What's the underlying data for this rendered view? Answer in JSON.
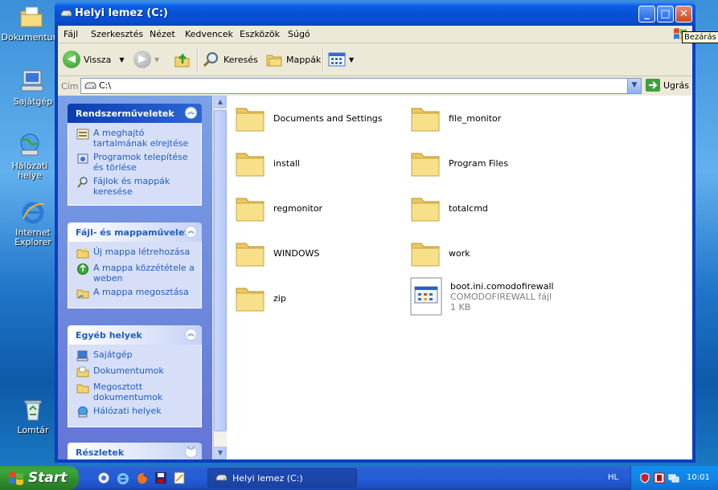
{
  "desktop": {
    "icons": [
      {
        "label": "Dokumentum",
        "icon": "my-documents-icon"
      },
      {
        "label": "Sajátgép",
        "icon": "my-computer-icon"
      },
      {
        "label": "Hálózati helye",
        "icon": "network-places-icon"
      },
      {
        "label": "Internet Explorer",
        "icon": "internet-explorer-icon"
      },
      {
        "label": "Lomtár",
        "icon": "recycle-bin-icon"
      }
    ]
  },
  "tooltip": "Bezárás",
  "window": {
    "title": "Helyi lemez (C:)",
    "menu": [
      "Fájl",
      "Szerkesztés",
      "Nézet",
      "Kedvencek",
      "Eszközök",
      "Súgó"
    ],
    "toolbar": {
      "back": "Vissza",
      "search": "Keresés",
      "folders": "Mappák"
    },
    "address": {
      "label": "Cím",
      "value": "C:\\",
      "go": "Ugrás"
    },
    "panels": {
      "system": {
        "title": "Rendszerműveletek",
        "tasks": [
          "A meghajtó tartalmának elrejtése",
          "Programok telepítése és törlése",
          "Fájlok és mappák keresése"
        ]
      },
      "file": {
        "title": "Fájl- és mappaművelet",
        "tasks": [
          "Új mappa létrehozása",
          "A mappa közzététele a weben",
          "A mappa megosztása"
        ]
      },
      "other": {
        "title": "Egyéb helyek",
        "tasks": [
          "Sajátgép",
          "Dokumentumok",
          "Megosztott dokumentumok",
          "Hálózati helyek"
        ]
      },
      "details": {
        "title": "Részletek"
      }
    },
    "items": [
      {
        "name": "Documents and Settings",
        "type": "folder"
      },
      {
        "name": "file_monitor",
        "type": "folder"
      },
      {
        "name": "install",
        "type": "folder"
      },
      {
        "name": "Program Files",
        "type": "folder"
      },
      {
        "name": "regmonitor",
        "type": "folder"
      },
      {
        "name": "totalcmd",
        "type": "folder"
      },
      {
        "name": "WINDOWS",
        "type": "folder"
      },
      {
        "name": "work",
        "type": "folder"
      },
      {
        "name": "zip",
        "type": "folder"
      },
      {
        "name": "boot.ini.comodofirewall",
        "type": "file",
        "filetype": "COMODOFIREWALL fájl",
        "size": "1 KB"
      }
    ]
  },
  "taskbar": {
    "start": "Start",
    "task_title": "Helyi lemez (C:)",
    "lang": "HL",
    "clock": "10:01"
  }
}
